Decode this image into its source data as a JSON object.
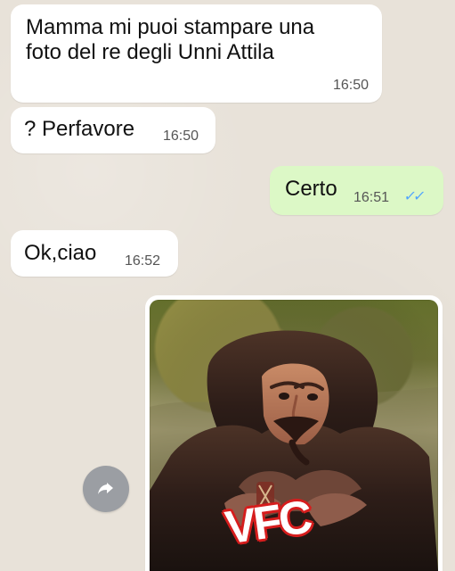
{
  "messages": [
    {
      "text": "Mamma mi puoi stampare una foto del re degli Unni Attila",
      "time": "16:50"
    },
    {
      "text": "? Perfavore",
      "time": "16:50"
    },
    {
      "text": "Certo",
      "time": "16:51",
      "status_icon": "double-check-icon"
    },
    {
      "text": "Ok,ciao",
      "time": "16:52"
    }
  ],
  "image_message": {
    "watermark": "VFC",
    "forward_icon": "forward-arrow-icon"
  },
  "colors": {
    "incoming_bubble": "#ffffff",
    "outgoing_bubble": "#dcf8c6",
    "read_tick": "#4fa3ff",
    "watermark_fill": "#ffffff",
    "watermark_outline": "#d61d1d"
  }
}
